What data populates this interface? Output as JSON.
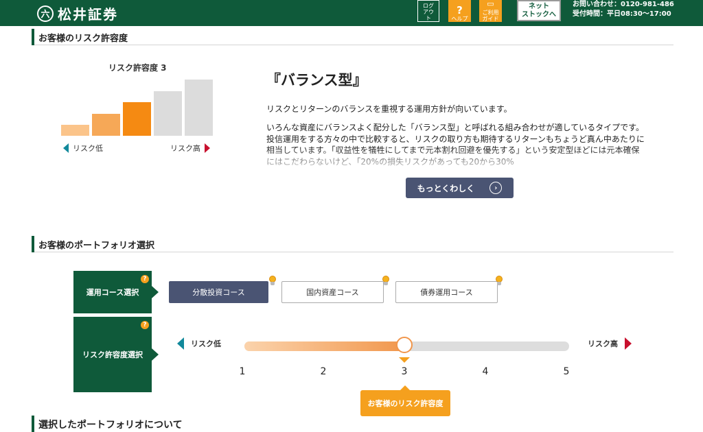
{
  "header": {
    "logo_mark": "六",
    "logo_text": "松井証券",
    "logout_label": "ログアウト",
    "help_label": "ヘルプ",
    "guide_label": "ご利用ガイド",
    "net_stock_line1": "ネット",
    "net_stock_line2": "ストックへ",
    "contact_line1": "お問い合わせ：0120-981-486",
    "contact_line2": "受付時間：平日08:30〜17:00"
  },
  "risk_section": {
    "heading": "お客様のリスク許容度",
    "chart_title": "リスク許容度 3",
    "low_label": "リスク低",
    "high_label": "リスク高",
    "levels": [
      1,
      2,
      3,
      4,
      5
    ],
    "current_level": 3,
    "colors": {
      "active_light": "#fbc48a",
      "active_mid": "#f6a857",
      "active_current": "#f58a12",
      "inactive": "#dcdcdc"
    }
  },
  "profile": {
    "title": "『バランス型』",
    "summary": "リスクとリターンのバランスを重視する運用方針が向いています。",
    "description": "いろんな資産にバランスよく配分した「バランス型」と呼ばれる組み合わせが適しているタイプです。投信運用をする方々の中で比較すると、リスクの取り方も期待するリターンもちょうど真ん中あたりに相当しています。「収益性を犠牲にしてまで元本割れ回避を優先する」という安定型ほどには元本確保にはこだわらないけど、「20%の損失リスクがあっても20から30%",
    "more_button": "もっとくわしく"
  },
  "portfolio_section": {
    "heading": "お客様のポートフォリオ選択",
    "course_label": "運用コース選択",
    "risk_label": "リスク許容度選択",
    "help_badge": "?",
    "courses": [
      "分散投資コース",
      "国内資産コース",
      "債券運用コース"
    ],
    "selected_course": "分散投資コース",
    "slider_low": "リスク低",
    "slider_high": "リスク高",
    "ticks": [
      "1",
      "2",
      "3",
      "4",
      "5"
    ],
    "slider_value": 3,
    "slider_min": 1,
    "slider_max": 5,
    "my_risk_label": "お客様のリスク許容度"
  },
  "next_section": {
    "heading": "選択したポートフォリオについて"
  }
}
